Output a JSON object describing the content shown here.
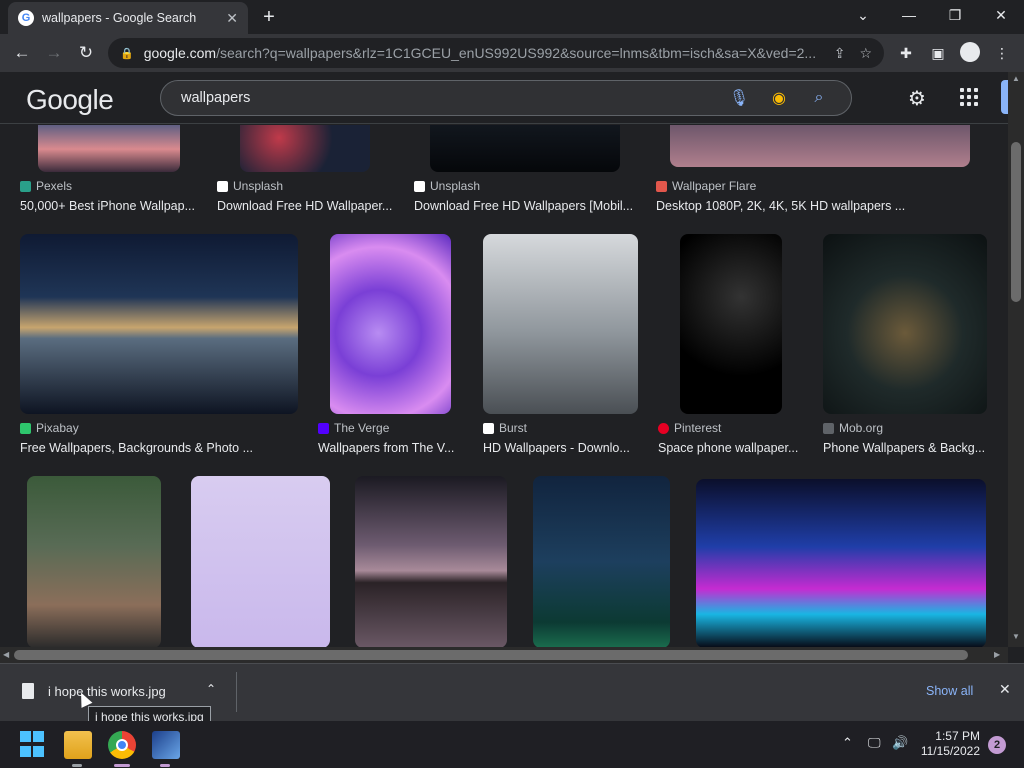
{
  "browser": {
    "tab_title": "wallpapers - Google Search",
    "url_domain": "google.com",
    "url_path": "/search?q=wallpapers&rlz=1C1GCEU_enUS992US992&source=lnms&tbm=isch&sa=X&ved=2..."
  },
  "google": {
    "logo_text": "Google",
    "query": "wallpapers"
  },
  "row1": [
    {
      "source": "Pexels",
      "fav_color": "#2aa08a",
      "fav_char": "P",
      "title": "50,000+ Best iPhone Wallpap..."
    },
    {
      "source": "Unsplash",
      "fav_color": "#000000",
      "fav_char": "U",
      "title": "Download Free HD Wallpaper..."
    },
    {
      "source": "Unsplash",
      "fav_color": "#000000",
      "fav_char": "U",
      "title": "Download Free HD Wallpapers [Mobil..."
    },
    {
      "source": "Wallpaper Flare",
      "fav_color": "#e2574c",
      "fav_char": "W",
      "title": "Desktop 1080P, 2K, 4K, 5K HD wallpapers ..."
    }
  ],
  "row2": [
    {
      "source": "Pixabay",
      "fav_color": "#2ec66d",
      "fav_char": "px",
      "title": "Free Wallpapers, Backgrounds & Photo ..."
    },
    {
      "source": "The Verge",
      "fav_color": "#5200ff",
      "fav_char": "V",
      "title": "Wallpapers from The V..."
    },
    {
      "source": "Burst",
      "fav_color": "#000000",
      "fav_char": "B",
      "title": "HD Wallpapers - Downlo..."
    },
    {
      "source": "Pinterest",
      "fav_color": "#e60023",
      "fav_char": "P",
      "title": "Space phone wallpaper..."
    },
    {
      "source": "Mob.org",
      "fav_color": "#3c4043",
      "fav_char": "m",
      "title": "Phone Wallpapers & Backg..."
    }
  ],
  "download": {
    "filename": "i hope this works.jpg",
    "tooltip": "i hope this works.jpg",
    "show_all": "Show all"
  },
  "taskbar": {
    "time": "1:57 PM",
    "date": "11/15/2022",
    "notification_count": "2"
  }
}
